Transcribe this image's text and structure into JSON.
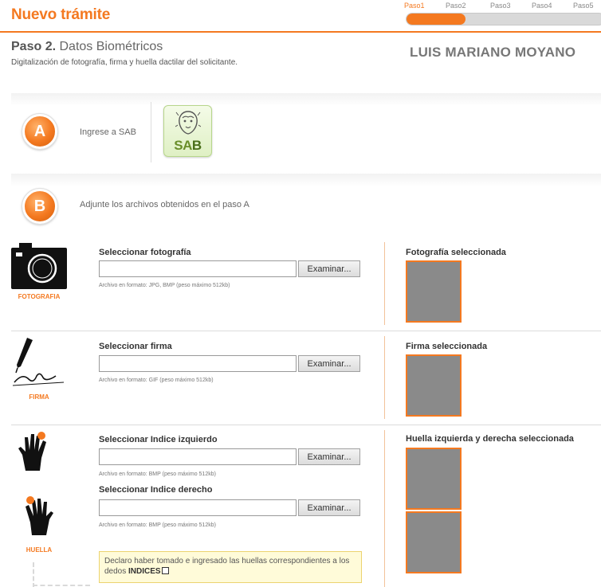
{
  "header": {
    "title": "Nuevo trámite",
    "steps": [
      "Paso1",
      "Paso2",
      "Paso3",
      "Paso4",
      "Paso5"
    ],
    "progress_fraction": 0.3
  },
  "step": {
    "number": "Paso 2.",
    "name": "Datos Biométricos",
    "description": "Digitalización de fotografía, firma y huella dactilar del solicitante."
  },
  "applicant_name": "LUIS MARIANO MOYANO",
  "section_a": {
    "badge": "A",
    "text": "Ingrese a SAB",
    "logo_text_1": "SA",
    "logo_text_2": "B"
  },
  "section_b": {
    "badge": "B",
    "text": "Adjunte los archivos obtenidos en el paso A"
  },
  "photo": {
    "caption": "FOTOGRAFIA",
    "field_label": "Seleccionar fotografía",
    "button": "Examinar...",
    "hint": "Archivo en formato: JPG, BMP (peso máximo 512kb)",
    "preview_title": "Fotografía seleccionada"
  },
  "signature": {
    "caption": "FIRMA",
    "field_label": "Seleccionar firma",
    "button": "Examinar...",
    "hint": "Archivo en formato: GIF (peso máximo 512kb)",
    "preview_title": "Firma seleccionada"
  },
  "fingerprint": {
    "caption": "HUELLA",
    "left_label": "Seleccionar Indice izquierdo",
    "right_label": "Seleccionar Indice derecho",
    "button": "Examinar...",
    "left_hint": "Archivo en formato: BMP (peso máximo 512kb)",
    "right_hint": "Archivo en formato: BMP (peso máximo 512kb)",
    "preview_title": "Huella izquierda y derecha seleccionada"
  },
  "declaration": {
    "text": "Declaro haber tomado e ingresado las huellas correspondientes a los dedos",
    "emphasis": "INDICES"
  },
  "colors": {
    "accent": "#f47920",
    "preview_fill": "#8a8a8a"
  }
}
